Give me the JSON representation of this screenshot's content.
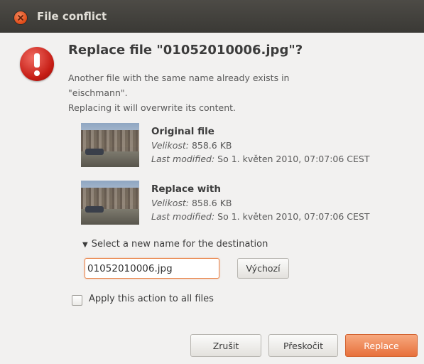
{
  "window": {
    "title": "File conflict"
  },
  "dialog": {
    "heading": "Replace file \"01052010006.jpg\"?",
    "secondary_lines": [
      "Another file with the same name already exists in",
      "\"eischmann\".",
      "Replacing it will overwrite its content."
    ]
  },
  "original": {
    "title": "Original file",
    "size_label": "Velikost:",
    "size_value": "858.6 KB",
    "modified_label": "Last modified:",
    "modified_value": "So 1. květen 2010, 07:07:06 CEST"
  },
  "replacement": {
    "title": "Replace with",
    "size_label": "Velikost:",
    "size_value": "858.6 KB",
    "modified_label": "Last modified:",
    "modified_value": "So 1. květen 2010, 07:07:06 CEST"
  },
  "rename": {
    "expander_label": "Select a new name for the destination",
    "input_value": "01052010006.jpg",
    "reset_label": "Výchozí"
  },
  "apply_all": {
    "label": "Apply this action to all files",
    "checked": false
  },
  "actions": {
    "cancel": "Zrušit",
    "skip": "Přeskočit",
    "replace": "Replace"
  },
  "icons": [
    "close-icon",
    "warning-icon",
    "expander-arrow-icon",
    "image-thumbnail"
  ],
  "colors": {
    "titlebar": "#3c3b37",
    "accent": "#e9854b",
    "warning": "#d42a21"
  }
}
